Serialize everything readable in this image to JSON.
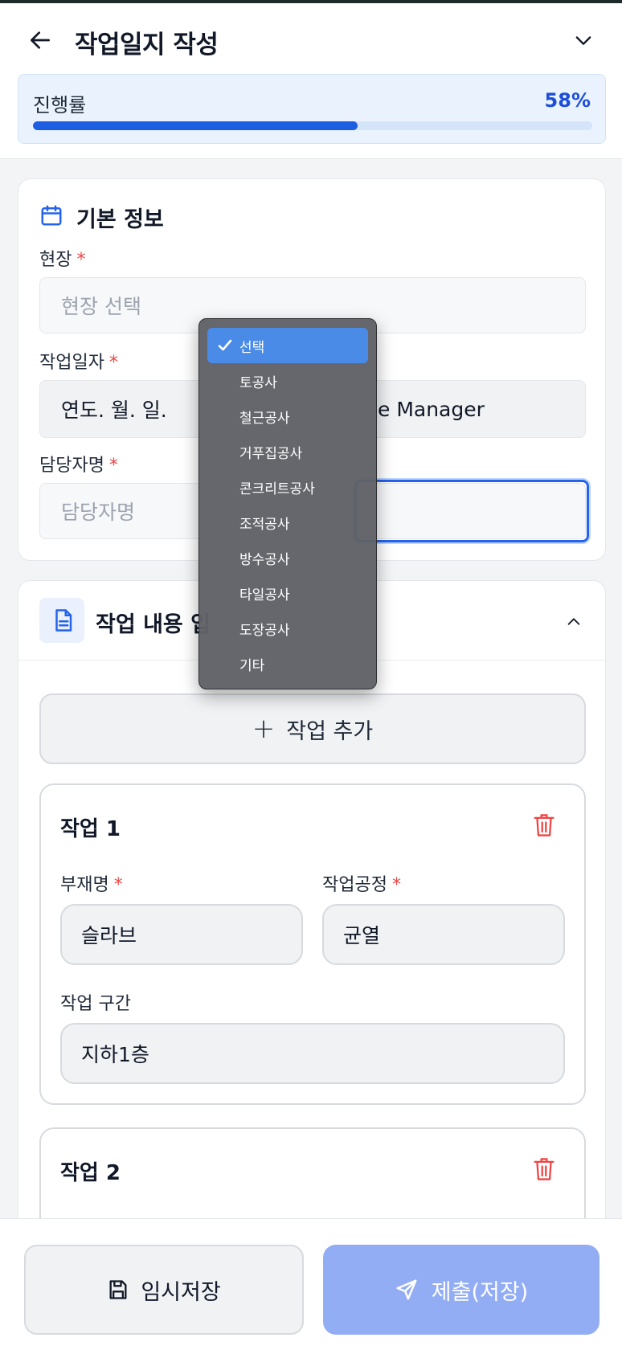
{
  "header": {
    "title": "작업일지 작성",
    "progress_label": "진행률",
    "progress_value": "58%",
    "progress_fraction": 0.58
  },
  "basic_info": {
    "title": "기본 정보",
    "site_label": "현장",
    "site_placeholder": "현장 선택",
    "date_label": "작업일자",
    "date_value": "연도. 월. 일.",
    "role_value_partial": "e Manager",
    "manager_label": "담당자명",
    "manager_placeholder": "담당자명",
    "required_mark": "*"
  },
  "work": {
    "title": "작업 내용 입",
    "add_button": "작업 추가",
    "tasks": [
      {
        "title": "작업 1",
        "member_label": "부재명",
        "member_value": "슬라브",
        "process_label": "작업공정",
        "process_value": "균열",
        "section_label": "작업 구간",
        "section_value": "지하1층"
      },
      {
        "title": "작업 2"
      }
    ]
  },
  "footer": {
    "draft_button": "임시저장",
    "submit_button": "제출(저장)"
  },
  "dropdown": {
    "options": [
      "선택",
      "토공사",
      "철근공사",
      "거푸집공사",
      "콘크리트공사",
      "조적공사",
      "방수공사",
      "타일공사",
      "도장공사",
      "기타"
    ],
    "selected_index": 0
  },
  "colors": {
    "accent": "#1d5fe0",
    "danger": "#ef4444",
    "submit_bg": "#93adf4"
  },
  "icons": [
    "back-arrow-icon",
    "chevron-down-icon",
    "calendar-icon",
    "document-icon",
    "chevron-up-icon",
    "plus-icon",
    "trash-icon",
    "save-icon",
    "send-icon",
    "check-icon"
  ]
}
